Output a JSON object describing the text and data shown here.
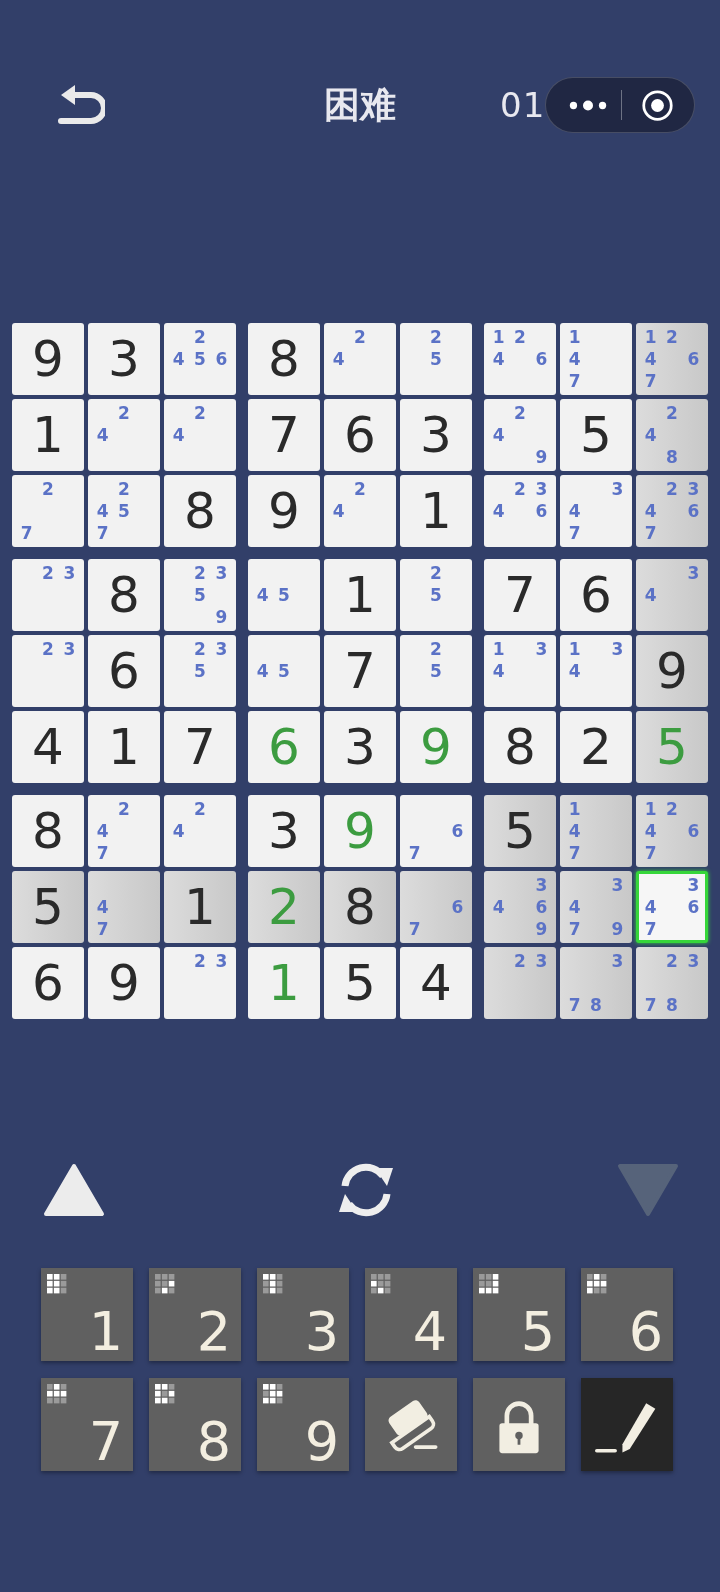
{
  "header": {
    "title": "困难",
    "timer": "01"
  },
  "grid": {
    "rows": [
      [
        {
          "kind": "given",
          "value": "9",
          "highlighted": false,
          "selected": false
        },
        {
          "kind": "given",
          "value": "3",
          "highlighted": false,
          "selected": false
        },
        {
          "kind": "notes",
          "notes": [
            "2",
            "4",
            "5",
            "6"
          ],
          "highlighted": false,
          "selected": false
        },
        {
          "kind": "given",
          "value": "8",
          "highlighted": false,
          "selected": false
        },
        {
          "kind": "notes",
          "notes": [
            "2",
            "4"
          ],
          "highlighted": false,
          "selected": false
        },
        {
          "kind": "notes",
          "notes": [
            "2",
            "5"
          ],
          "highlighted": false,
          "selected": false
        },
        {
          "kind": "notes",
          "notes": [
            "1",
            "2",
            "4",
            "6"
          ],
          "highlighted": false,
          "selected": false
        },
        {
          "kind": "notes",
          "notes": [
            "1",
            "4",
            "7"
          ],
          "highlighted": false,
          "selected": false
        },
        {
          "kind": "notes",
          "notes": [
            "1",
            "2",
            "4",
            "6",
            "7"
          ],
          "highlighted": true,
          "selected": false
        }
      ],
      [
        {
          "kind": "given",
          "value": "1",
          "highlighted": false,
          "selected": false
        },
        {
          "kind": "notes",
          "notes": [
            "2",
            "4"
          ],
          "highlighted": false,
          "selected": false
        },
        {
          "kind": "notes",
          "notes": [
            "2",
            "4"
          ],
          "highlighted": false,
          "selected": false
        },
        {
          "kind": "given",
          "value": "7",
          "highlighted": false,
          "selected": false
        },
        {
          "kind": "given",
          "value": "6",
          "highlighted": false,
          "selected": false
        },
        {
          "kind": "given",
          "value": "3",
          "highlighted": false,
          "selected": false
        },
        {
          "kind": "notes",
          "notes": [
            "2",
            "4",
            "9"
          ],
          "highlighted": false,
          "selected": false
        },
        {
          "kind": "given",
          "value": "5",
          "highlighted": false,
          "selected": false
        },
        {
          "kind": "notes",
          "notes": [
            "2",
            "4",
            "8"
          ],
          "highlighted": true,
          "selected": false
        }
      ],
      [
        {
          "kind": "notes",
          "notes": [
            "2",
            "7"
          ],
          "highlighted": false,
          "selected": false
        },
        {
          "kind": "notes",
          "notes": [
            "2",
            "4",
            "5",
            "7"
          ],
          "highlighted": false,
          "selected": false
        },
        {
          "kind": "given",
          "value": "8",
          "highlighted": false,
          "selected": false
        },
        {
          "kind": "given",
          "value": "9",
          "highlighted": false,
          "selected": false
        },
        {
          "kind": "notes",
          "notes": [
            "2",
            "4"
          ],
          "highlighted": false,
          "selected": false
        },
        {
          "kind": "given",
          "value": "1",
          "highlighted": false,
          "selected": false
        },
        {
          "kind": "notes",
          "notes": [
            "2",
            "3",
            "4",
            "6"
          ],
          "highlighted": false,
          "selected": false
        },
        {
          "kind": "notes",
          "notes": [
            "3",
            "4",
            "7"
          ],
          "highlighted": false,
          "selected": false
        },
        {
          "kind": "notes",
          "notes": [
            "2",
            "3",
            "4",
            "6",
            "7"
          ],
          "highlighted": true,
          "selected": false
        }
      ],
      [
        {
          "kind": "notes",
          "notes": [
            "2",
            "3"
          ],
          "highlighted": false,
          "selected": false
        },
        {
          "kind": "given",
          "value": "8",
          "highlighted": false,
          "selected": false
        },
        {
          "kind": "notes",
          "notes": [
            "2",
            "3",
            "5",
            "9"
          ],
          "highlighted": false,
          "selected": false
        },
        {
          "kind": "notes",
          "notes": [
            "4",
            "5"
          ],
          "highlighted": false,
          "selected": false
        },
        {
          "kind": "given",
          "value": "1",
          "highlighted": false,
          "selected": false
        },
        {
          "kind": "notes",
          "notes": [
            "2",
            "5"
          ],
          "highlighted": false,
          "selected": false
        },
        {
          "kind": "given",
          "value": "7",
          "highlighted": false,
          "selected": false
        },
        {
          "kind": "given",
          "value": "6",
          "highlighted": false,
          "selected": false
        },
        {
          "kind": "notes",
          "notes": [
            "3",
            "4"
          ],
          "highlighted": true,
          "selected": false
        }
      ],
      [
        {
          "kind": "notes",
          "notes": [
            "2",
            "3"
          ],
          "highlighted": false,
          "selected": false
        },
        {
          "kind": "given",
          "value": "6",
          "highlighted": false,
          "selected": false
        },
        {
          "kind": "notes",
          "notes": [
            "2",
            "3",
            "5"
          ],
          "highlighted": false,
          "selected": false
        },
        {
          "kind": "notes",
          "notes": [
            "4",
            "5"
          ],
          "highlighted": false,
          "selected": false
        },
        {
          "kind": "given",
          "value": "7",
          "highlighted": false,
          "selected": false
        },
        {
          "kind": "notes",
          "notes": [
            "2",
            "5"
          ],
          "highlighted": false,
          "selected": false
        },
        {
          "kind": "notes",
          "notes": [
            "1",
            "3",
            "4"
          ],
          "highlighted": false,
          "selected": false
        },
        {
          "kind": "notes",
          "notes": [
            "1",
            "3",
            "4"
          ],
          "highlighted": false,
          "selected": false
        },
        {
          "kind": "given",
          "value": "9",
          "highlighted": true,
          "selected": false
        }
      ],
      [
        {
          "kind": "given",
          "value": "4",
          "highlighted": false,
          "selected": false
        },
        {
          "kind": "given",
          "value": "1",
          "highlighted": false,
          "selected": false
        },
        {
          "kind": "given",
          "value": "7",
          "highlighted": false,
          "selected": false
        },
        {
          "kind": "solved",
          "value": "6",
          "highlighted": false,
          "selected": false
        },
        {
          "kind": "given",
          "value": "3",
          "highlighted": false,
          "selected": false
        },
        {
          "kind": "solved",
          "value": "9",
          "highlighted": false,
          "selected": false
        },
        {
          "kind": "given",
          "value": "8",
          "highlighted": false,
          "selected": false
        },
        {
          "kind": "given",
          "value": "2",
          "highlighted": false,
          "selected": false
        },
        {
          "kind": "solved",
          "value": "5",
          "highlighted": true,
          "selected": false
        }
      ],
      [
        {
          "kind": "given",
          "value": "8",
          "highlighted": false,
          "selected": false
        },
        {
          "kind": "notes",
          "notes": [
            "2",
            "4",
            "7"
          ],
          "highlighted": false,
          "selected": false
        },
        {
          "kind": "notes",
          "notes": [
            "2",
            "4"
          ],
          "highlighted": false,
          "selected": false
        },
        {
          "kind": "given",
          "value": "3",
          "highlighted": false,
          "selected": false
        },
        {
          "kind": "solved",
          "value": "9",
          "highlighted": false,
          "selected": false
        },
        {
          "kind": "notes",
          "notes": [
            "6",
            "7"
          ],
          "highlighted": false,
          "selected": false
        },
        {
          "kind": "given",
          "value": "5",
          "highlighted": true,
          "selected": false
        },
        {
          "kind": "notes",
          "notes": [
            "1",
            "4",
            "7"
          ],
          "highlighted": true,
          "selected": false
        },
        {
          "kind": "notes",
          "notes": [
            "1",
            "2",
            "4",
            "6",
            "7"
          ],
          "highlighted": true,
          "selected": false
        }
      ],
      [
        {
          "kind": "given",
          "value": "5",
          "highlighted": true,
          "selected": false
        },
        {
          "kind": "notes",
          "notes": [
            "4",
            "7"
          ],
          "highlighted": true,
          "selected": false
        },
        {
          "kind": "given",
          "value": "1",
          "highlighted": true,
          "selected": false
        },
        {
          "kind": "solved",
          "value": "2",
          "highlighted": true,
          "selected": false
        },
        {
          "kind": "given",
          "value": "8",
          "highlighted": true,
          "selected": false
        },
        {
          "kind": "notes",
          "notes": [
            "6",
            "7"
          ],
          "highlighted": true,
          "selected": false
        },
        {
          "kind": "notes",
          "notes": [
            "3",
            "4",
            "6",
            "9"
          ],
          "highlighted": true,
          "selected": false
        },
        {
          "kind": "notes",
          "notes": [
            "3",
            "4",
            "7",
            "9"
          ],
          "highlighted": true,
          "selected": false
        },
        {
          "kind": "notes",
          "notes": [
            "3",
            "4",
            "6",
            "7"
          ],
          "highlighted": false,
          "selected": true
        }
      ],
      [
        {
          "kind": "given",
          "value": "6",
          "highlighted": false,
          "selected": false
        },
        {
          "kind": "given",
          "value": "9",
          "highlighted": false,
          "selected": false
        },
        {
          "kind": "notes",
          "notes": [
            "2",
            "3"
          ],
          "highlighted": false,
          "selected": false
        },
        {
          "kind": "solved",
          "value": "1",
          "highlighted": false,
          "selected": false
        },
        {
          "kind": "given",
          "value": "5",
          "highlighted": false,
          "selected": false
        },
        {
          "kind": "given",
          "value": "4",
          "highlighted": false,
          "selected": false
        },
        {
          "kind": "notes",
          "notes": [
            "2",
            "3"
          ],
          "highlighted": true,
          "selected": false
        },
        {
          "kind": "notes",
          "notes": [
            "3",
            "7",
            "8"
          ],
          "highlighted": true,
          "selected": false
        },
        {
          "kind": "notes",
          "notes": [
            "2",
            "3",
            "7",
            "8"
          ],
          "highlighted": true,
          "selected": false
        }
      ]
    ]
  },
  "nav": {
    "up_disabled": false,
    "down_disabled": true
  },
  "keypad": {
    "keys": [
      {
        "kind": "digit",
        "label": "1"
      },
      {
        "kind": "digit",
        "label": "2"
      },
      {
        "kind": "digit",
        "label": "3"
      },
      {
        "kind": "digit",
        "label": "4"
      },
      {
        "kind": "digit",
        "label": "5"
      },
      {
        "kind": "digit",
        "label": "6"
      },
      {
        "kind": "digit",
        "label": "7"
      },
      {
        "kind": "digit",
        "label": "8"
      },
      {
        "kind": "digit",
        "label": "9"
      },
      {
        "kind": "erase",
        "selected": false
      },
      {
        "kind": "lock",
        "selected": false
      },
      {
        "kind": "pencil",
        "selected": true
      }
    ]
  }
}
